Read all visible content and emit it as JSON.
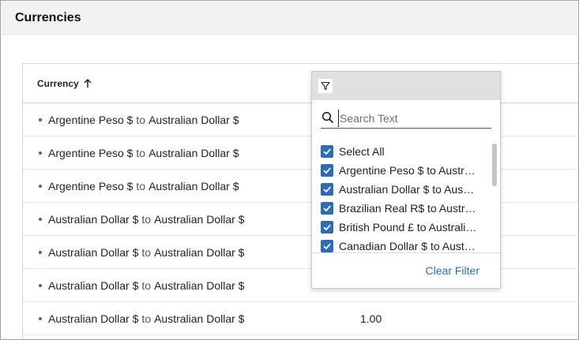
{
  "page": {
    "title": "Currencies"
  },
  "grid": {
    "column_header": "Currency",
    "sort_icon": "arrow-up-icon",
    "rows": [
      {
        "from": "Argentine Peso $",
        "to_word": "to",
        "to": "Australian Dollar $",
        "rate": ""
      },
      {
        "from": "Argentine Peso $",
        "to_word": "to",
        "to": "Australian Dollar $",
        "rate": ""
      },
      {
        "from": "Argentine Peso $",
        "to_word": "to",
        "to": "Australian Dollar $",
        "rate": ""
      },
      {
        "from": "Australian Dollar $",
        "to_word": "to",
        "to": "Australian Dollar $",
        "rate": ""
      },
      {
        "from": "Australian Dollar $",
        "to_word": "to",
        "to": "Australian Dollar $",
        "rate": ""
      },
      {
        "from": "Australian Dollar $",
        "to_word": "to",
        "to": "Australian Dollar $",
        "rate": ""
      },
      {
        "from": "Australian Dollar $",
        "to_word": "to",
        "to": "Australian Dollar $",
        "rate": "1.00"
      }
    ]
  },
  "filter": {
    "tab_icon": "filter-icon",
    "search_placeholder": "Search Text",
    "search_value": "",
    "items": [
      {
        "label": "Select All",
        "checked": true
      },
      {
        "label": "Argentine Peso $ to Australian Dollar $",
        "checked": true
      },
      {
        "label": "Australian Dollar $ to Australian Dollar $",
        "checked": true
      },
      {
        "label": "Brazilian Real R$ to Australian Dollar $",
        "checked": true
      },
      {
        "label": "British Pound £ to Australian Dollar $",
        "checked": true
      },
      {
        "label": "Canadian Dollar $ to Australian Dollar $",
        "checked": true
      }
    ],
    "clear_label": "Clear Filter"
  },
  "colors": {
    "accent": "#2c6db8",
    "link": "#2a6ebd",
    "header_bg": "#f1f2f4"
  }
}
